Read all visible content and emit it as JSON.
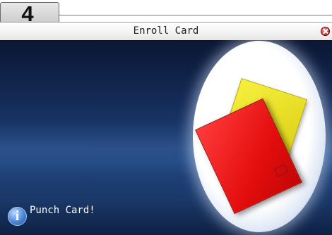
{
  "step": {
    "number": "4"
  },
  "window": {
    "title": "Enroll Card",
    "close_icon": "close-icon"
  },
  "illustration": {
    "cards": [
      "yellow-card",
      "red-card"
    ],
    "card_colors": [
      "#f6f03e",
      "#e40e0e"
    ]
  },
  "status": {
    "icon": "info-icon",
    "icon_glyph": "i",
    "message": "Punch Card!"
  },
  "colors": {
    "background": "#1f447e",
    "title_bar": "#f2f2f2"
  }
}
